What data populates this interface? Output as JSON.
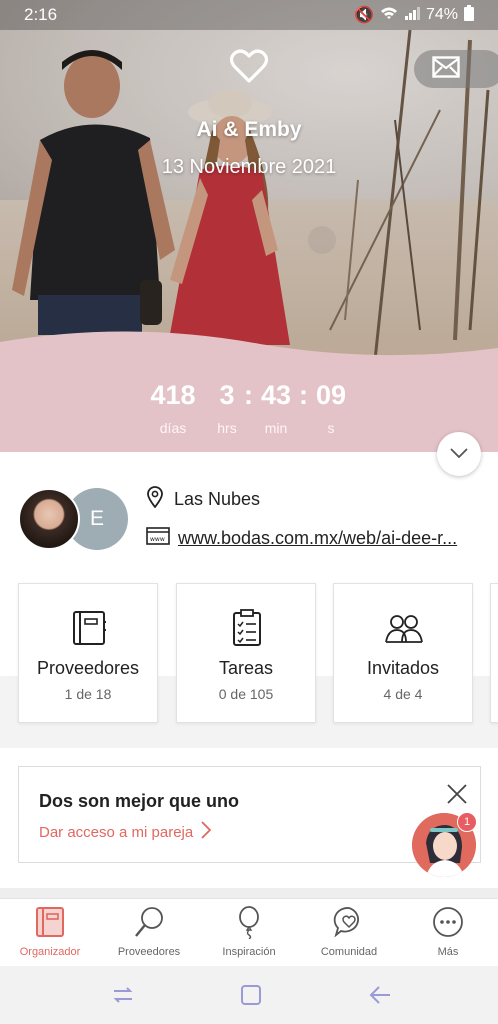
{
  "status_bar": {
    "time": "2:16",
    "battery": "74%"
  },
  "hero": {
    "names": "Ai & Emby",
    "date": "13 Noviembre 2021"
  },
  "countdown": {
    "days": "418",
    "days_label": "días",
    "hours": "3",
    "hours_label": "hrs",
    "minutes": "43",
    "minutes_label": "min",
    "seconds": "09",
    "seconds_label": "s"
  },
  "info": {
    "avatar_initial": "E",
    "location": "Las Nubes",
    "website": "www.bodas.com.mx/web/ai-dee-r..."
  },
  "cards": [
    {
      "title": "Proveedores",
      "subtitle": "1 de 18"
    },
    {
      "title": "Tareas",
      "subtitle": "0 de 105"
    },
    {
      "title": "Invitados",
      "subtitle": "4 de 4"
    }
  ],
  "partner": {
    "title": "Dos son mejor que uno",
    "link": "Dar acceso a mi pareja",
    "badge_count": "1"
  },
  "bottom_nav": [
    {
      "label": "Organizador",
      "active": true
    },
    {
      "label": "Proveedores"
    },
    {
      "label": "Inspiración"
    },
    {
      "label": "Comunidad"
    },
    {
      "label": "Más"
    }
  ],
  "colors": {
    "accent": "#e0685f",
    "countdown_bg": "#e3c3c7",
    "avatar_bg": "#9eadb4"
  }
}
